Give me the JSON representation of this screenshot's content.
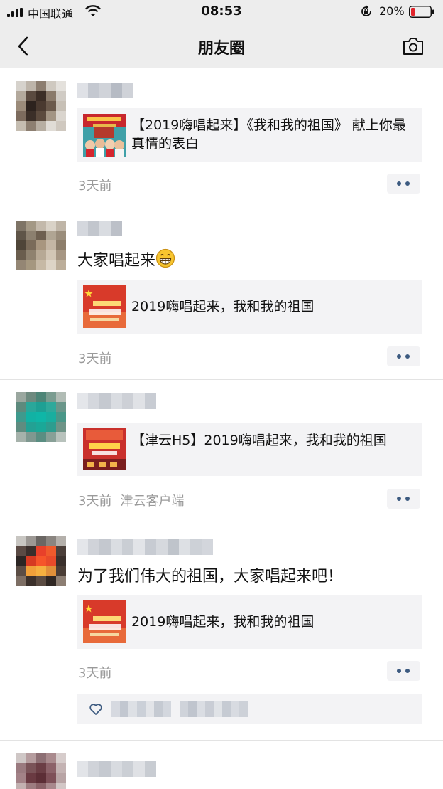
{
  "status_bar": {
    "carrier": "中国联通",
    "time": "08:53",
    "battery": "20%",
    "battery_level": 0.2
  },
  "nav": {
    "title": "朋友圈"
  },
  "posts": [
    {
      "text": "",
      "link_title": "【2019嗨唱起来】《我和我的祖国》 献上你最真情的表白",
      "time": "3天前",
      "source": ""
    },
    {
      "text": "大家唱起来",
      "link_title": "2019嗨唱起来，我和我的祖国",
      "time": "3天前",
      "source": ""
    },
    {
      "text": "",
      "link_title": "【津云H5】2019嗨唱起来，我和我的祖国",
      "time": "3天前",
      "source": "津云客户端"
    },
    {
      "text": "为了我们伟大的祖国，大家唱起来吧！",
      "link_title": "2019嗨唱起来，我和我的祖国",
      "time": "3天前",
      "source": ""
    }
  ],
  "colors": {
    "header_bg": "#ededed",
    "card_bg": "#f3f3f5",
    "link_blue": "#3c5a80",
    "meta_gray": "#9a9a9a"
  },
  "icons": [
    "back-icon",
    "camera-icon",
    "more-icon",
    "heart-icon",
    "wifi-icon",
    "signal-icon",
    "battery-icon",
    "orientation-lock-icon",
    "grin-emoji-icon"
  ]
}
